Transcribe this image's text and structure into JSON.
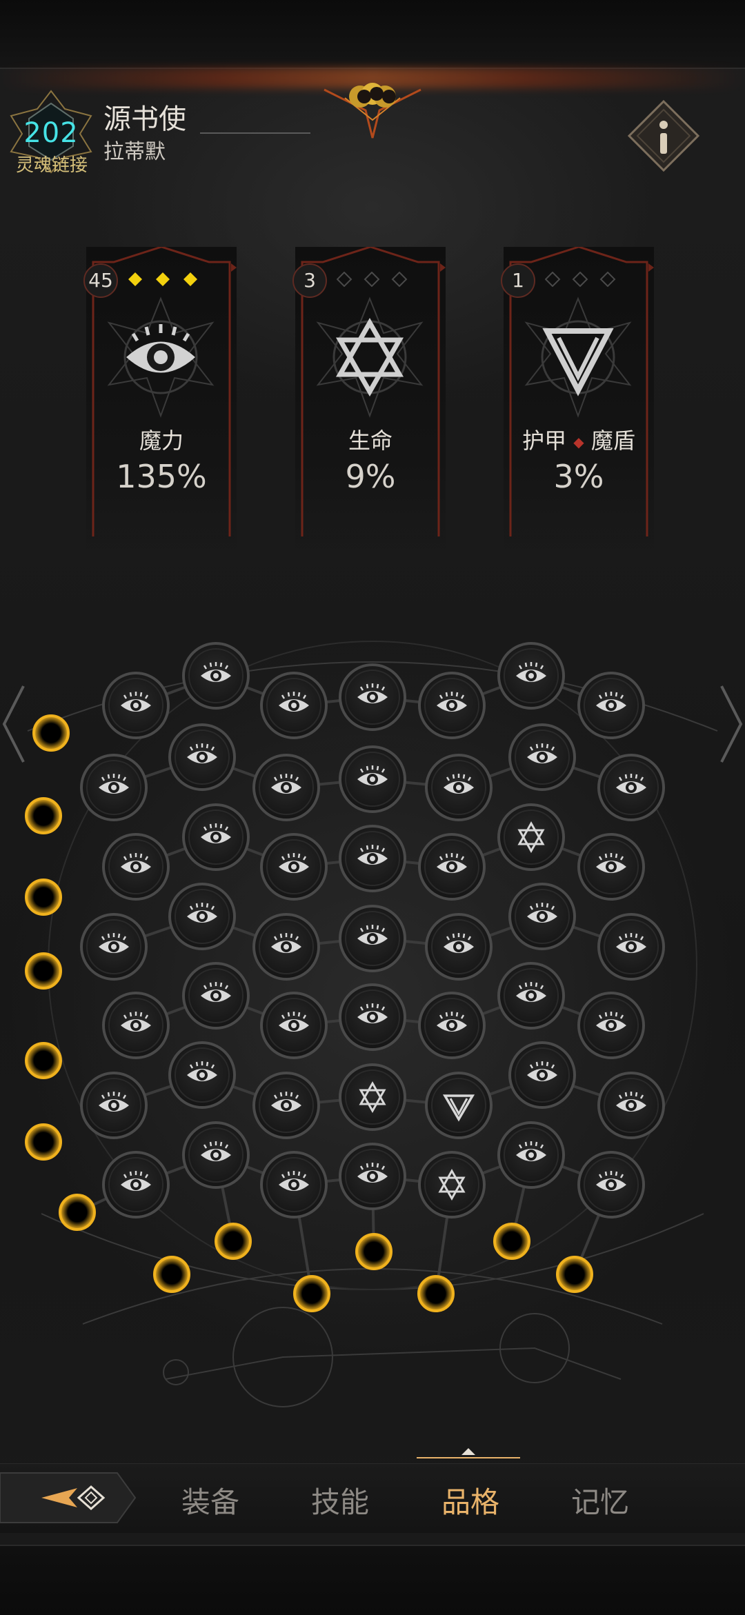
{
  "header": {
    "level": "202",
    "level_caption": "灵魂链接",
    "name": "源书使",
    "subtitle": "拉蒂默"
  },
  "cards": [
    {
      "count": "45",
      "gems_filled": 3,
      "label": "魔力",
      "value": "135%",
      "icon": "eye-icon"
    },
    {
      "count": "3",
      "gems_filled": 0,
      "label": "生命",
      "value": "9%",
      "icon": "hexagram-icon"
    },
    {
      "count": "1",
      "gems_filled": 0,
      "label_a": "护甲",
      "label_b": "魔盾",
      "value": "3%",
      "icon": "triangle-rune-icon"
    }
  ],
  "colors": {
    "accent_gold": "#f0b21e",
    "level_cyan": "#46e3e6",
    "active_tab": "#e9b36a",
    "frame_red": "#6d2419"
  },
  "grid": {
    "icon_types": [
      "eye-icon",
      "hexagram-icon",
      "triangle-rune-icon"
    ]
  },
  "nav": {
    "tabs": [
      {
        "label": "装备",
        "active": false
      },
      {
        "label": "技能",
        "active": false
      },
      {
        "label": "品格",
        "active": true
      },
      {
        "label": "记忆",
        "active": false
      }
    ]
  }
}
